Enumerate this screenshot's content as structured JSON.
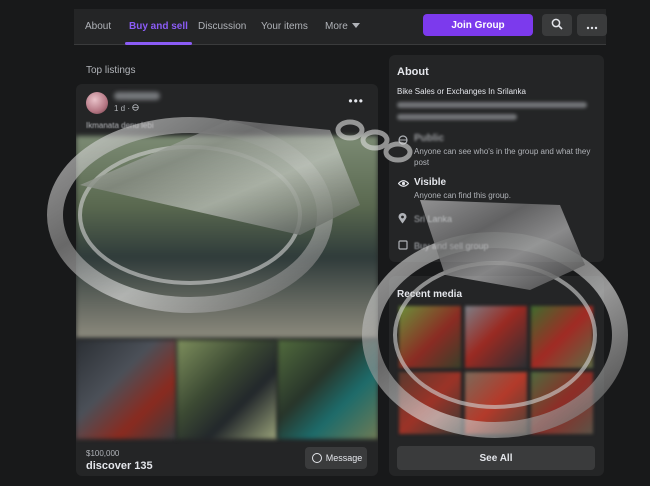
{
  "nav": {
    "tabs": [
      {
        "label": "About"
      },
      {
        "label": "Buy and sell"
      },
      {
        "label": "Discussion"
      },
      {
        "label": "Your items"
      },
      {
        "label": "More"
      }
    ],
    "join_label": "Join Group",
    "search_icon": "search-icon",
    "more_icon": "more-dots-icon"
  },
  "listings": {
    "section_title": "Top listings",
    "post": {
      "meta": "1 d · ",
      "caption": "Ikmanata denu lebi",
      "price": "$100,000",
      "title": "discover 135",
      "message_label": "Message"
    }
  },
  "about": {
    "title": "About",
    "group_name": "Bike Sales or Exchanges In Srilanka",
    "rows": [
      {
        "icon": "globe-icon",
        "head": "Public",
        "sub": "Anyone can see who's in the group and what they post"
      },
      {
        "icon": "eye-icon",
        "head": "Visible",
        "sub": "Anyone can find this group."
      },
      {
        "icon": "location-icon",
        "head": "Sri Lanka",
        "sub": ""
      },
      {
        "icon": "tag-icon",
        "head": "Buy and sell group",
        "sub": ""
      }
    ]
  },
  "media": {
    "title": "Recent media",
    "see_all_label": "See All"
  },
  "colors": {
    "accent": "#7c3aed",
    "background": "#18191a",
    "card": "#242526"
  }
}
